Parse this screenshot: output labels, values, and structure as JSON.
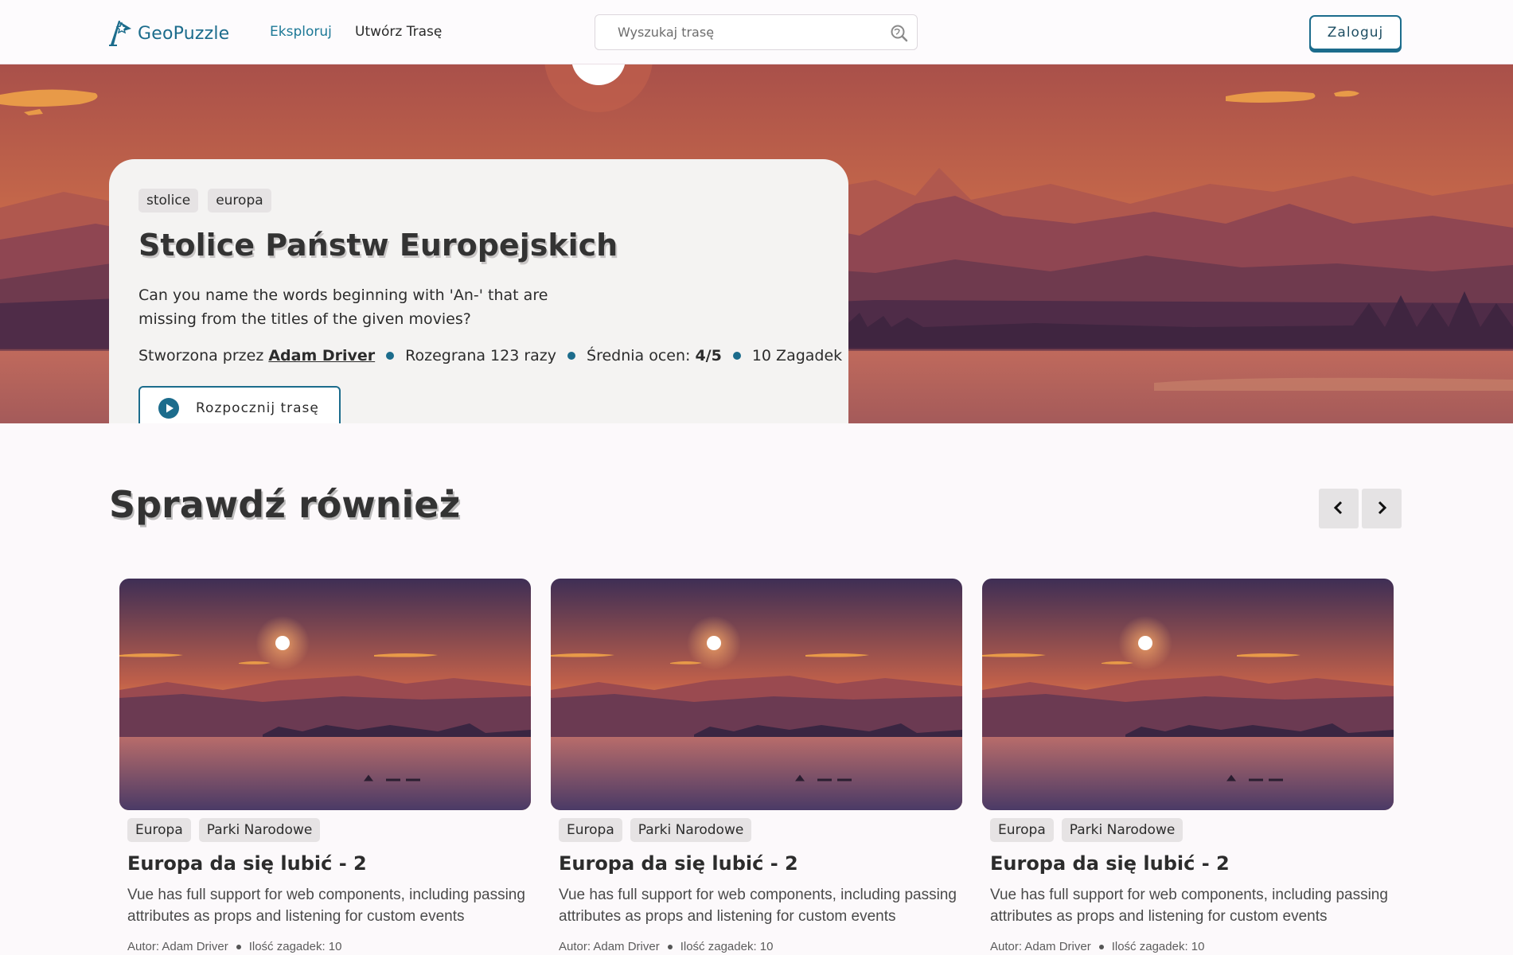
{
  "nav": {
    "logo_text": "GeoPuzzle",
    "links": [
      "Eksploruj",
      "Utwórz Trasę"
    ],
    "search_placeholder": "Wyszukaj trasę",
    "login_label": "Zaloguj"
  },
  "hero": {
    "tags": [
      "stolice",
      "europa"
    ],
    "title": "Stolice Państw Europejskich",
    "description": "Can you name the words beginning with 'An-' that are missing from the titles of the given movies?",
    "created_by_label": "Stworzona przez",
    "author": "Adam Driver",
    "played": "Rozegrana 123 razy",
    "rating_label": "Średnia ocen:",
    "rating_value": "4/5",
    "puzzles": "10 Zagadek",
    "start_label": "Rozpocznij trasę"
  },
  "section": {
    "title": "Sprawdź również"
  },
  "cards": [
    {
      "tags": [
        "Europa",
        "Parki Narodowe"
      ],
      "title": "Europa da się lubić - 2",
      "description": "Vue has full support for web components, including passing attributes as props and listening for custom events",
      "author": "Autor: Adam Driver",
      "count": "Ilość zagadek: 10"
    },
    {
      "tags": [
        "Europa",
        "Parki Narodowe"
      ],
      "title": "Europa da się lubić - 2",
      "description": "Vue has full support for web components, including passing attributes as props and listening for custom events",
      "author": "Autor: Adam Driver",
      "count": "Ilość zagadek: 10"
    },
    {
      "tags": [
        "Europa",
        "Parki Narodowe"
      ],
      "title": "Europa da się lubić - 2",
      "description": "Vue has full support for web components, including passing attributes as props and listening for custom events",
      "author": "Autor: Adam Driver",
      "count": "Ilość zagadek: 10"
    }
  ],
  "colors": {
    "accent": "#1c6c8c",
    "background": "#fcf9fb",
    "hero_sky": "#b8564a",
    "tag_bg": "#e6e3e4"
  }
}
